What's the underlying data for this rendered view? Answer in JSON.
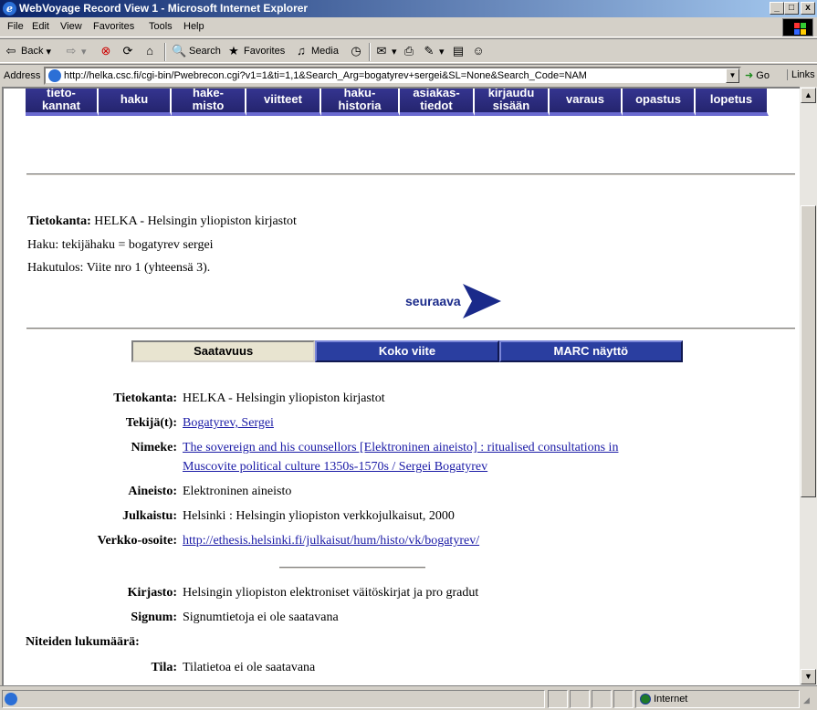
{
  "window": {
    "title": "WebVoyage Record View 1 - Microsoft Internet Explorer",
    "controls": [
      "_",
      "□",
      "x"
    ]
  },
  "menu": [
    "File",
    "Edit",
    "View",
    "Favorites",
    "Tools",
    "Help"
  ],
  "toolbar": {
    "back": "Back",
    "search": "Search",
    "favorites": "Favorites",
    "media": "Media"
  },
  "address": {
    "label": "Address",
    "url": "http://helka.csc.fi/cgi-bin/Pwebrecon.cgi?v1=1&ti=1,1&Search_Arg=bogatyrev+sergei&SL=None&Search_Code=NAM",
    "go": "Go",
    "links": "Links"
  },
  "nav": [
    {
      "line1": "tieto-",
      "line2": "kannat"
    },
    {
      "line1": "haku",
      "line2": ""
    },
    {
      "line1": "hake-",
      "line2": "misto"
    },
    {
      "line1": "viitteet",
      "line2": ""
    },
    {
      "line1": "haku-",
      "line2": "historia"
    },
    {
      "line1": "asiakas-",
      "line2": "tiedot"
    },
    {
      "line1": "kirjaudu",
      "line2": "sisään"
    },
    {
      "line1": "varaus",
      "line2": ""
    },
    {
      "line1": "opastus",
      "line2": ""
    },
    {
      "line1": "lopetus",
      "line2": ""
    }
  ],
  "search_info": {
    "db_label": "Tietokanta:",
    "db_value": "HELKA - Helsingin yliopiston kirjastot",
    "query": "Haku: tekijähaku = bogatyrev sergei",
    "result": "Hakutulos: Viite nro 1 (yhteensä 3).",
    "next": "seuraava"
  },
  "tabs": [
    "Saatavuus",
    "Koko viite",
    "MARC näyttö"
  ],
  "record": {
    "fields": [
      {
        "label": "Tietokanta:",
        "value": "HELKA - Helsingin yliopiston kirjastot",
        "link": false
      },
      {
        "label": "Tekijä(t):",
        "value": "Bogatyrev, Sergei",
        "link": true
      },
      {
        "label": "Nimeke:",
        "value": "The sovereign and his counsellors [Elektroninen aineisto] : ritualised consultations in",
        "value2": "Muscovite political culture 1350s-1570s / Sergei Bogatyrev",
        "link": true
      },
      {
        "label": "Aineisto:",
        "value": "Elektroninen aineisto",
        "link": false
      },
      {
        "label": "Julkaistu:",
        "value": "Helsinki : Helsingin yliopiston verkkojulkaisut, 2000",
        "link": false
      },
      {
        "label": "Verkko-osoite:",
        "value": "http://ethesis.helsinki.fi/julkaisut/hum/histo/vk/bogatyrev/",
        "link": true
      }
    ],
    "holdings": [
      {
        "label": "Kirjasto:",
        "value": "Helsingin yliopiston elektroniset väitöskirjat ja pro gradut"
      },
      {
        "label": "Signum:",
        "value": "Signumtietoja ei ole saatavana"
      },
      {
        "label": "Niteiden lukumäärä:",
        "value": ""
      },
      {
        "label": "Tila:",
        "value": "Tilatietoa ei ole saatavana"
      }
    ]
  },
  "status": {
    "zone": "Internet"
  }
}
